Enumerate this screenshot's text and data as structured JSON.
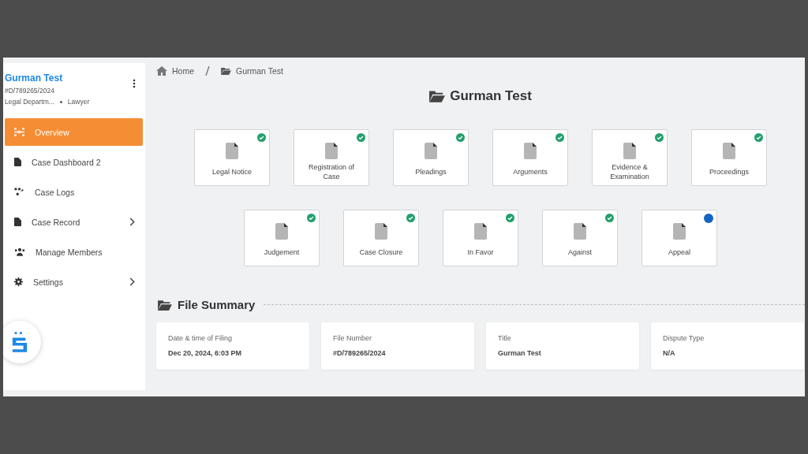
{
  "sidebar": {
    "case_title": "Gurman Test",
    "case_number": "#D/789265/2024",
    "department": "Legal Departm...",
    "role": "Lawyer",
    "items": [
      {
        "label": "Overview",
        "selected": true,
        "expandable": false
      },
      {
        "label": "Case Dashboard 2",
        "selected": false,
        "expandable": false
      },
      {
        "label": "Case Logs",
        "selected": false,
        "expandable": false
      },
      {
        "label": "Case Record",
        "selected": false,
        "expandable": true
      },
      {
        "label": "Manage Members",
        "selected": false,
        "expandable": false
      },
      {
        "label": "Settings",
        "selected": false,
        "expandable": true
      }
    ]
  },
  "breadcrumb": [
    "Home",
    "Gurman Test"
  ],
  "page_title": "Gurman Test",
  "stage_rows": [
    [
      {
        "label": "Legal Notice",
        "completed": true
      },
      {
        "label": "Registration of Case",
        "completed": true
      },
      {
        "label": "Pleadings",
        "completed": true
      },
      {
        "label": "Arguments",
        "completed": true
      },
      {
        "label": "Evidence & Examination",
        "completed": true
      },
      {
        "label": "Proceedings",
        "completed": true
      }
    ],
    [
      {
        "label": "Judgement",
        "completed": true
      },
      {
        "label": "Case Closure",
        "completed": true
      },
      {
        "label": "In Favor",
        "completed": true
      },
      {
        "label": "Against",
        "completed": true
      },
      {
        "label": "Appeal",
        "completed": false
      }
    ]
  ],
  "file_summary": {
    "heading": "File Summary",
    "fields": [
      {
        "label": "Date & time of Filing",
        "value": "Dec 20, 2024, 6:03 PM"
      },
      {
        "label": "File Number",
        "value": "#D/789265/2024"
      },
      {
        "label": "Title",
        "value": "Gurman Test"
      },
      {
        "label": "Dispute Type",
        "value": "N/A"
      }
    ]
  }
}
